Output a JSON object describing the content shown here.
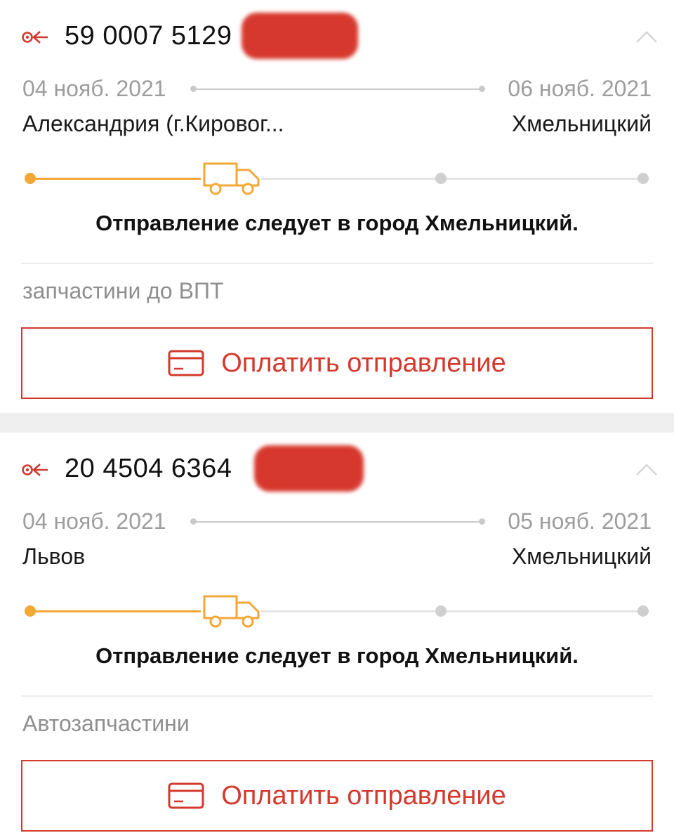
{
  "colors": {
    "accent_red": "#d33a2e",
    "progress_orange": "#f3a736",
    "muted_gray": "#9d9d9d",
    "separator": "#efefef"
  },
  "shipments": [
    {
      "tracking_number": "59 0007 5129",
      "direction_icon": "outgoing-arrow-icon",
      "collapse_icon": "chevron-up-icon",
      "departure_date": "04 нояб. 2021",
      "arrival_date": "06 нояб. 2021",
      "origin_city": "Александрия (г.Кировог...",
      "destination_city": "Хмельницкий",
      "progress_stage": "2 of 4",
      "status_text": "Отправление следует в город Хмельницкий.",
      "description": "запчастини до ВПТ",
      "pay_button_label": "Оплатить отправление"
    },
    {
      "tracking_number": "20 4504 6364",
      "direction_icon": "outgoing-arrow-icon",
      "collapse_icon": "chevron-up-icon",
      "departure_date": "04 нояб. 2021",
      "arrival_date": "05 нояб. 2021",
      "origin_city": "Львов",
      "destination_city": "Хмельницкий",
      "progress_stage": "2 of 4",
      "status_text": "Отправление следует в город Хмельницкий.",
      "description": "Автозапчастини",
      "pay_button_label": "Оплатить отправление"
    }
  ]
}
